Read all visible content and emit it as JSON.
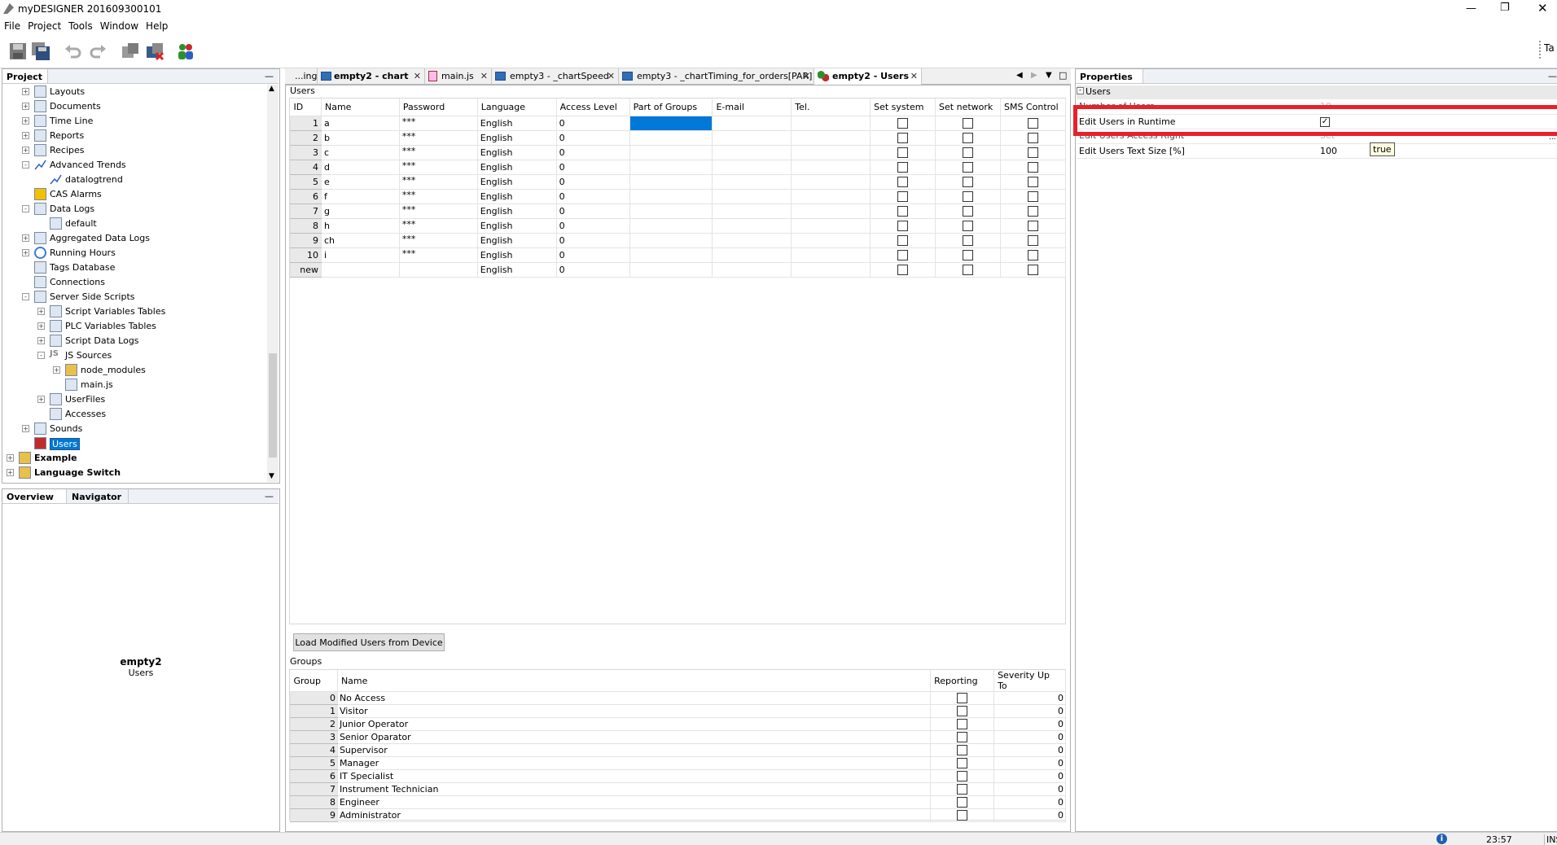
{
  "title": "myDESIGNER 201609300101",
  "menu": [
    "File",
    "Project",
    "Tools",
    "Window",
    "Help"
  ],
  "toolbar_icons": [
    "save-icon",
    "save-all-icon",
    "undo-icon",
    "redo-icon",
    "download-icon",
    "upload-icon",
    "users-icon"
  ],
  "toolbar_right": "Ta",
  "project": {
    "title": "Project",
    "items": [
      {
        "label": "Layouts",
        "icon": "layouts-icon"
      },
      {
        "label": "Documents",
        "icon": "documents-icon"
      },
      {
        "label": "Time Line",
        "icon": "timeline-icon"
      },
      {
        "label": "Reports",
        "icon": "reports-icon"
      },
      {
        "label": "Recipes",
        "icon": "recipes-icon"
      },
      {
        "label": "Advanced Trends",
        "icon": "trend-icon"
      },
      {
        "label": "datalogtrend",
        "icon": "trend-icon"
      },
      {
        "label": "CAS Alarms",
        "icon": "alarm-icon"
      },
      {
        "label": "Data Logs",
        "icon": "datalog-icon"
      },
      {
        "label": "default",
        "icon": "datalog-icon"
      },
      {
        "label": "Aggregated Data Logs",
        "icon": "datalog-icon"
      },
      {
        "label": "Running Hours",
        "icon": "clock-icon"
      },
      {
        "label": "Tags Database",
        "icon": "database-icon"
      },
      {
        "label": "Connections",
        "icon": "connections-icon"
      },
      {
        "label": "Server Side Scripts",
        "icon": "scripts-icon"
      },
      {
        "label": "Script Variables Tables",
        "icon": "table-icon"
      },
      {
        "label": "PLC Variables Tables",
        "icon": "table-icon"
      },
      {
        "label": "Script Data Logs",
        "icon": "datalog-icon"
      },
      {
        "label": "JS Sources",
        "icon": "js-icon"
      },
      {
        "label": "node_modules",
        "icon": "folder-icon"
      },
      {
        "label": "main.js",
        "icon": "file-icon"
      },
      {
        "label": "UserFiles",
        "icon": "userfiles-icon"
      },
      {
        "label": "Accesses",
        "icon": "key-icon"
      },
      {
        "label": "Sounds",
        "icon": "sound-icon"
      },
      {
        "label": "Users",
        "icon": "users-icon"
      },
      {
        "label": "Example",
        "icon": "project-folder-icon"
      },
      {
        "label": "Language Switch",
        "icon": "project-folder-icon"
      }
    ]
  },
  "overview": {
    "tab1": "Overview",
    "tab2": "Navigator",
    "name": "empty2",
    "sub": "Users"
  },
  "tabs": [
    "...ing",
    "empty2 - chart",
    "main.js",
    "empty3 - _chartSpeed",
    "empty3 - _chartTiming_for_orders[PAR]",
    "empty2 - Users"
  ],
  "users": {
    "section": "Users",
    "columns": [
      "ID",
      "Name",
      "Password",
      "Language",
      "Access Level",
      "Part of Groups",
      "E-mail",
      "Tel.",
      "Set system",
      "Set network",
      "SMS Control"
    ],
    "rows": [
      {
        "id": "1",
        "name": "a",
        "pw": "***",
        "lang": "English",
        "lvl": "0"
      },
      {
        "id": "2",
        "name": "b",
        "pw": "***",
        "lang": "English",
        "lvl": "0"
      },
      {
        "id": "3",
        "name": "c",
        "pw": "***",
        "lang": "English",
        "lvl": "0"
      },
      {
        "id": "4",
        "name": "d",
        "pw": "***",
        "lang": "English",
        "lvl": "0"
      },
      {
        "id": "5",
        "name": "e",
        "pw": "***",
        "lang": "English",
        "lvl": "0"
      },
      {
        "id": "6",
        "name": "f",
        "pw": "***",
        "lang": "English",
        "lvl": "0"
      },
      {
        "id": "7",
        "name": "g",
        "pw": "***",
        "lang": "English",
        "lvl": "0"
      },
      {
        "id": "8",
        "name": "h",
        "pw": "***",
        "lang": "English",
        "lvl": "0"
      },
      {
        "id": "9",
        "name": "ch",
        "pw": "***",
        "lang": "English",
        "lvl": "0"
      },
      {
        "id": "10",
        "name": "i",
        "pw": "***",
        "lang": "English",
        "lvl": "0"
      },
      {
        "id": "new",
        "name": "",
        "pw": "",
        "lang": "English",
        "lvl": "0"
      }
    ],
    "load_button": "Load Modified Users from Device"
  },
  "groups": {
    "section": "Groups",
    "columns": [
      "Group",
      "Name",
      "Reporting",
      "Severity Up To"
    ],
    "rows": [
      {
        "g": "0",
        "name": "No Access",
        "sev": "0"
      },
      {
        "g": "1",
        "name": "Visitor",
        "sev": "0"
      },
      {
        "g": "2",
        "name": "Junior Operator",
        "sev": "0"
      },
      {
        "g": "3",
        "name": "Senior Oparator",
        "sev": "0"
      },
      {
        "g": "4",
        "name": "Supervisor",
        "sev": "0"
      },
      {
        "g": "5",
        "name": "Manager",
        "sev": "0"
      },
      {
        "g": "6",
        "name": "IT Specialist",
        "sev": "0"
      },
      {
        "g": "7",
        "name": "Instrument Technician",
        "sev": "0"
      },
      {
        "g": "8",
        "name": "Engineer",
        "sev": "0"
      },
      {
        "g": "9",
        "name": "Administrator",
        "sev": "0"
      }
    ]
  },
  "properties": {
    "title": "Properties",
    "section": "Users",
    "rows": [
      {
        "label": "Number of Users",
        "value": "10",
        "cut": true
      },
      {
        "label": "Edit Users in Runtime",
        "value": "",
        "checkbox": true,
        "checked": true
      },
      {
        "label": "Edit Users Access Right",
        "value": "Set",
        "cut": true
      },
      {
        "label": "Edit Users Text Size [%]",
        "value": "100"
      }
    ],
    "tooltip": "true"
  },
  "status": {
    "time": "23:57",
    "mode": "INS"
  },
  "colors": {
    "highlight": "#e8202a",
    "selection": "#0078d7"
  }
}
